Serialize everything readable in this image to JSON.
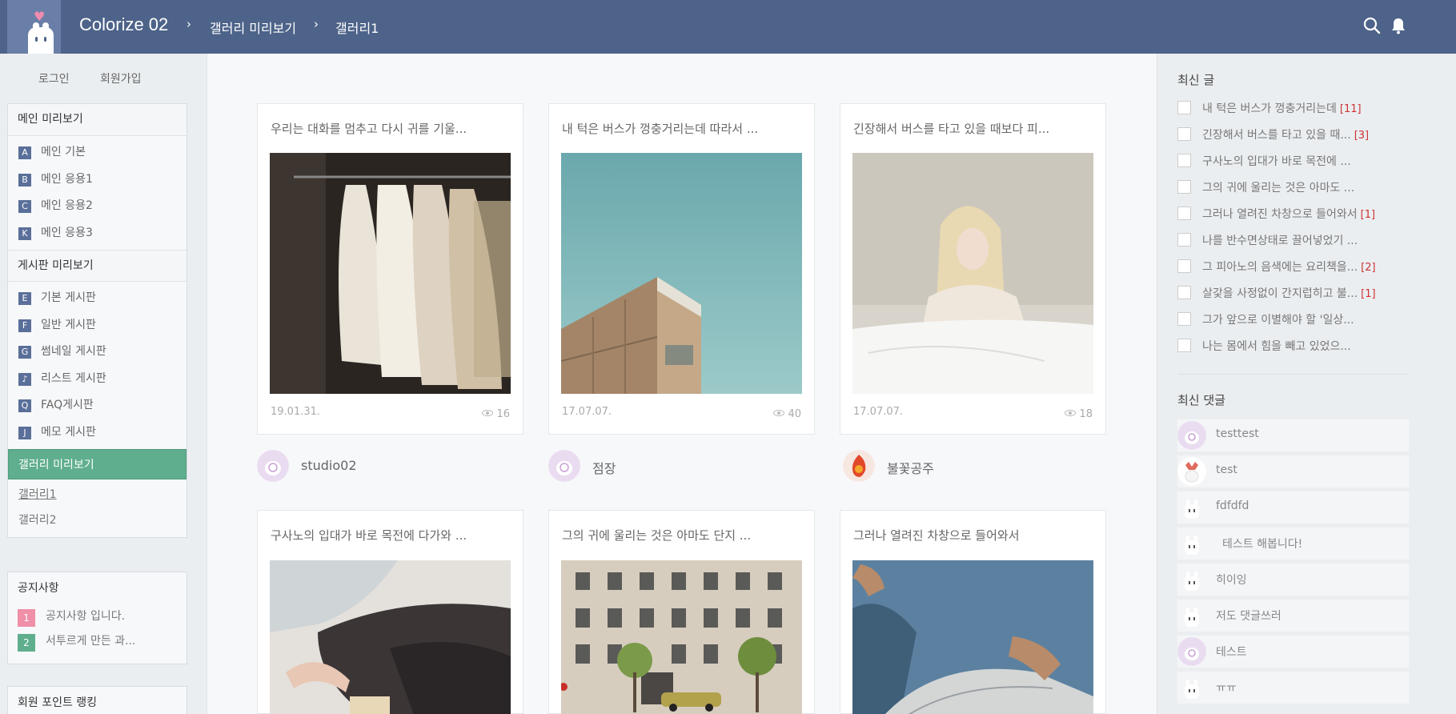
{
  "header": {
    "site_title": "Colorize 02",
    "breadcrumb": [
      "갤러리 미리보기",
      "갤러리1"
    ],
    "search_icon": "search-icon",
    "bell_icon": "bell-icon",
    "accent": "#4d6389"
  },
  "auth": {
    "login": "로그인",
    "signup": "회원가입"
  },
  "sidebar": {
    "main_preview": {
      "title": "메인 미리보기",
      "items": [
        {
          "badge": "A",
          "label": "메인 기본"
        },
        {
          "badge": "B",
          "label": "메인 응용1"
        },
        {
          "badge": "C",
          "label": "메인 응용2"
        },
        {
          "badge": "K",
          "label": "메인 응용3"
        }
      ]
    },
    "board_preview": {
      "title": "게시판 미리보기",
      "items": [
        {
          "badge": "E",
          "label": "기본 게시판"
        },
        {
          "badge": "F",
          "label": "일반 게시판"
        },
        {
          "badge": "G",
          "label": "썸네일 게시판"
        },
        {
          "badge": "♪",
          "label": "리스트 게시판"
        },
        {
          "badge": "Q",
          "label": "FAQ게시판"
        },
        {
          "badge": "J",
          "label": "메모 게시판"
        }
      ]
    },
    "gallery_preview": {
      "title": "갤러리 미리보기",
      "items": [
        "갤러리1",
        "갤러리2"
      ],
      "accent": "#5fae8e"
    },
    "notice": {
      "title": "공지사항",
      "items": [
        {
          "num": "1",
          "text": "공지사항 입니다.",
          "color": "#ef8fa8"
        },
        {
          "num": "2",
          "text": "서투르게 만든 과...",
          "color": "#5fae8e"
        }
      ]
    },
    "ranking": {
      "title": "회원 포인트 랭킹"
    }
  },
  "gallery": [
    {
      "title": "우리는 대화를 멈추고 다시 귀를 기울...",
      "date": "19.01.31.",
      "views": "16",
      "author": "studio02"
    },
    {
      "title": "내 턱은 버스가 껑충거리는데 따라서 ...",
      "date": "17.07.07.",
      "views": "40",
      "author": "점장"
    },
    {
      "title": "긴장해서 버스를 타고 있을 때보다 피...",
      "date": "17.07.07.",
      "views": "18",
      "author": "불꽃공주"
    },
    {
      "title": "구사노의 입대가 바로 목전에 다가와 ..."
    },
    {
      "title": "그의 귀에 울리는 것은 아마도 단지 ..."
    },
    {
      "title": "그러나 열려진 차창으로 들어와서"
    }
  ],
  "recent_posts": {
    "title": "최신 글",
    "items": [
      {
        "text": "내 턱은 버스가 껑충거리는데",
        "count": "[11]"
      },
      {
        "text": "긴장해서 버스를 타고 있을 때...",
        "count": "[3]"
      },
      {
        "text": "구사노의 입대가 바로 목전에 ...",
        "count": ""
      },
      {
        "text": "그의 귀에 울리는 것은 아마도 ...",
        "count": ""
      },
      {
        "text": "그러나 열려진 차창으로 들어와서",
        "count": "[1]"
      },
      {
        "text": "나를 반수면상태로 끌어넣었기 ...",
        "count": ""
      },
      {
        "text": "그 피아노의 음색에는 요리책을...",
        "count": "[2]"
      },
      {
        "text": "살갗을 사정없이 간지럽히고 불...",
        "count": "[1]"
      },
      {
        "text": "그가 앞으로 이별해야 할 '일상...",
        "count": ""
      },
      {
        "text": "나는 몸에서 힘을 빼고 있었으...",
        "count": ""
      }
    ]
  },
  "recent_comments": {
    "title": "최신 댓글",
    "items": [
      "testtest",
      "test",
      "fdfdfd",
      "테스트 해봅니다!",
      "히이잉",
      "저도 댓글쓰러",
      "테스트",
      "ㅠㅠ"
    ]
  }
}
